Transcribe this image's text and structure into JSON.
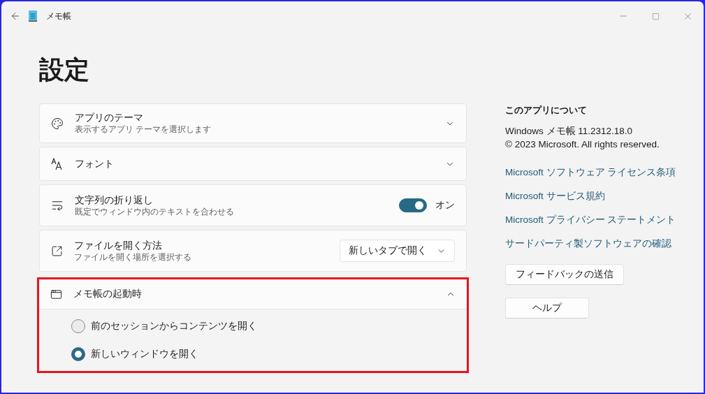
{
  "window": {
    "title": "メモ帳"
  },
  "heading": "設定",
  "settings": [
    {
      "kind": "expander",
      "title": "アプリのテーマ",
      "description": "表示するアプリ テーマを選択します",
      "expanded": false
    },
    {
      "kind": "expander",
      "title": "フォント",
      "expanded": false
    },
    {
      "kind": "toggle",
      "title": "文字列の折り返し",
      "description": "既定でウィンドウ内のテキストを合わせる",
      "on": true,
      "state_label": "オン"
    },
    {
      "kind": "dropdown",
      "title": "ファイルを開く方法",
      "description": "ファイルを開く場所を選択する",
      "value": "新しいタブで開く"
    },
    {
      "kind": "expander",
      "title": "メモ帳の起動時",
      "expanded": true,
      "highlighted": true,
      "options": [
        {
          "label": "前のセッションからコンテンツを開く",
          "selected": false
        },
        {
          "label": "新しいウィンドウを開く",
          "selected": true
        }
      ]
    }
  ],
  "about": {
    "heading": "このアプリについて",
    "version": "Windows メモ帳 11.2312.18.0",
    "copyright": "© 2023 Microsoft. All rights reserved.",
    "links": [
      "Microsoft ソフトウェア ライセンス条項",
      "Microsoft サービス規約",
      "Microsoft プライバシー ステートメント",
      "サードパーティ製ソフトウェアの確認"
    ],
    "buttons": [
      "フィードバックの送信",
      "ヘルプ"
    ]
  }
}
